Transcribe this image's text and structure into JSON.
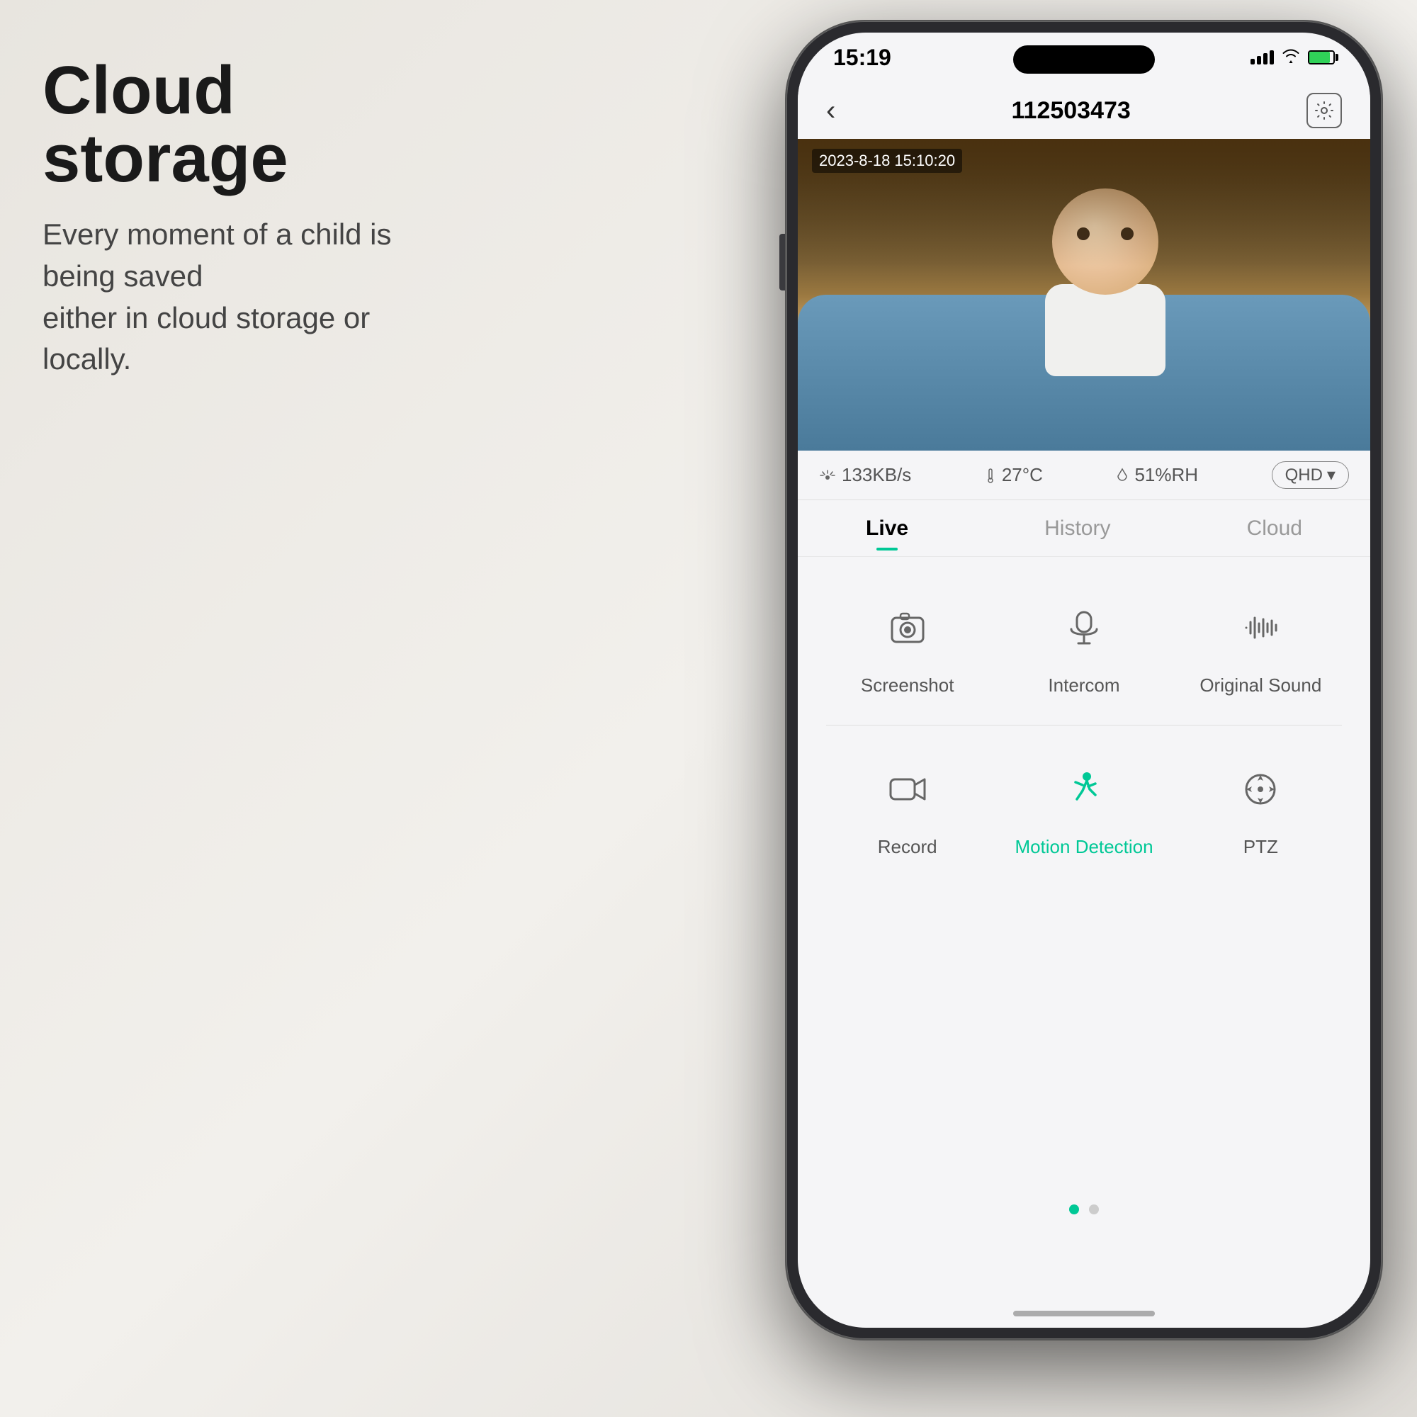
{
  "page": {
    "background": "#e8e5df"
  },
  "hero": {
    "headline": "Cloud storage",
    "subtitle_line1": "Every moment of a child is being saved",
    "subtitle_line2": "either in cloud storage or locally."
  },
  "phone": {
    "status_bar": {
      "time": "15:19"
    },
    "header": {
      "back_label": "‹",
      "camera_id": "112503473",
      "settings_icon": "⬡"
    },
    "video": {
      "timestamp": "2023-8-18  15:10:20"
    },
    "stats": {
      "speed": "133KB/s",
      "temperature": "27°C",
      "humidity": "51%RH",
      "quality": "QHD"
    },
    "tabs": [
      {
        "label": "Live",
        "active": true
      },
      {
        "label": "History",
        "active": false
      },
      {
        "label": "Cloud",
        "active": false
      }
    ],
    "functions_row1": [
      {
        "id": "screenshot",
        "label": "Screenshot",
        "icon": "camera",
        "active": false
      },
      {
        "id": "intercom",
        "label": "Intercom",
        "icon": "mic",
        "active": false
      },
      {
        "id": "original-sound",
        "label": "Original Sound",
        "icon": "waveform",
        "active": false
      }
    ],
    "functions_row2": [
      {
        "id": "record",
        "label": "Record",
        "icon": "video",
        "active": false
      },
      {
        "id": "motion-detection",
        "label": "Motion Detection",
        "icon": "figure-run",
        "active": true
      },
      {
        "id": "ptz",
        "label": "PTZ",
        "icon": "compass",
        "active": false
      }
    ],
    "page_dots": [
      {
        "active": true
      },
      {
        "active": false
      }
    ]
  }
}
